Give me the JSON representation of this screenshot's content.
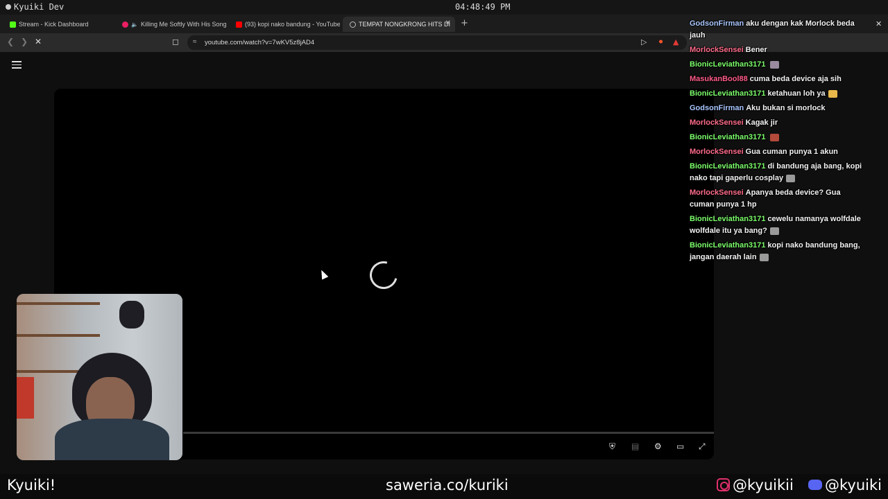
{
  "topbar": {
    "workspace": "Kyuiki Dev",
    "clock": "04:48:49 PM"
  },
  "tabs": [
    {
      "title": "Stream - Kick Dashboard",
      "favicon_color": "#53fc18"
    },
    {
      "title": "Killing Me Softly With His Song",
      "favicon_color": "#e91e63",
      "playing_icon": "speaker-icon"
    },
    {
      "title": "(93) kopi nako bandung - YouTube",
      "favicon_color": "#ff0000"
    },
    {
      "title": "TEMPAT NONGKRONG HITS DI",
      "favicon_color": "#bbbbbb"
    }
  ],
  "address_bar": {
    "url": "youtube.com/watch?v=7wKV5z8jAD4"
  },
  "chat": [
    {
      "user": "GodsonFirman",
      "color": "#aac7ff",
      "text": "aku dengan kak Morlock beda jauh"
    },
    {
      "user": "MorlockSensei",
      "color": "#ff6b8a",
      "text": "Bener"
    },
    {
      "user": "BionicLeviathan3171",
      "color": "#7cff6b",
      "text": "",
      "emote": "#9a8aa0"
    },
    {
      "user": "MasukanBool88",
      "color": "#ff5c8a",
      "text": "cuma beda device aja sih"
    },
    {
      "user": "BionicLeviathan3171",
      "color": "#7cff6b",
      "text": "ketahuan loh ya",
      "emote": "#e8b84a"
    },
    {
      "user": "GodsonFirman",
      "color": "#aac7ff",
      "text": "Aku bukan si morlock"
    },
    {
      "user": "MorlockSensei",
      "color": "#ff6b8a",
      "text": "Kagak jir"
    },
    {
      "user": "BionicLeviathan3171",
      "color": "#7cff6b",
      "text": "",
      "emote": "#b34a3a"
    },
    {
      "user": "MorlockSensei",
      "color": "#ff6b8a",
      "text": "Gua cuman punya 1 akun"
    },
    {
      "user": "BionicLeviathan3171",
      "color": "#7cff6b",
      "text": "di bandung aja bang, kopi nako tapi gaperlu cosplay",
      "emote": "#9a9a9a"
    },
    {
      "user": "MorlockSensei",
      "color": "#ff6b8a",
      "text": "Apanya beda device? Gua cuman punya 1 hp"
    },
    {
      "user": "BionicLeviathan3171",
      "color": "#7cff6b",
      "text": "cewelu namanya wolfdale wolfdale itu ya bang?",
      "emote": "#9a9a9a"
    },
    {
      "user": "BionicLeviathan3171",
      "color": "#7cff6b",
      "text": "kopi nako bandung bang, jangan daerah lain",
      "emote": "#9a9a9a"
    }
  ],
  "overlay": {
    "name": "Kyuiki!",
    "donation": "saweria.co/kuriki",
    "instagram": "@kyuikii",
    "discord": "@kyuiki"
  }
}
